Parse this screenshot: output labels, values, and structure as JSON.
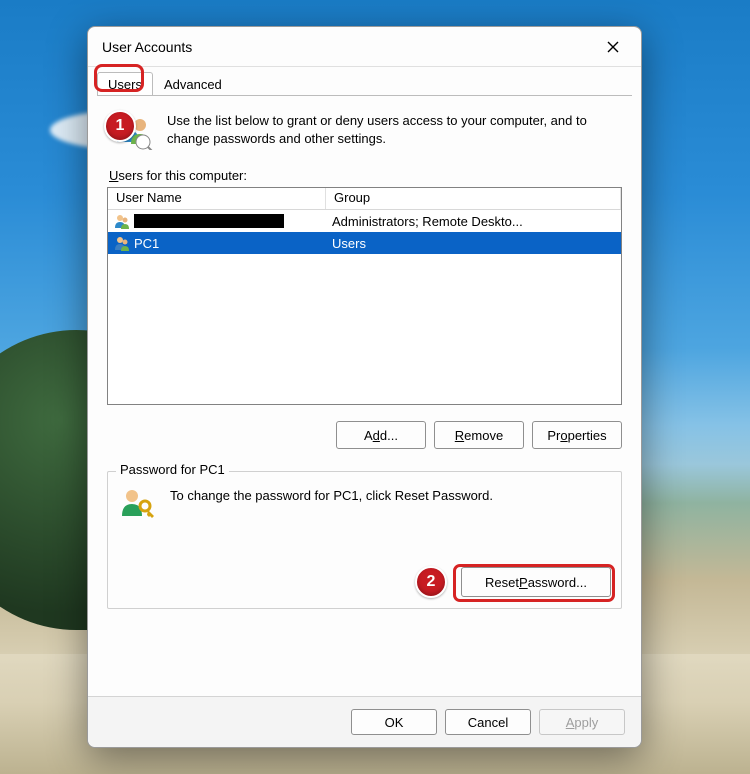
{
  "dialog": {
    "title": "User Accounts",
    "tabs": {
      "users": "Users",
      "advanced": "Advanced"
    },
    "intro": "Use the list below to grant or deny users access to your computer, and to change passwords and other settings.",
    "list_label_prefix": "U",
    "list_label_rest": "sers for this computer:",
    "columns": {
      "name": "User Name",
      "group": "Group"
    },
    "rows": [
      {
        "name_redacted": true,
        "name": "",
        "group": "Administrators; Remote Deskto...",
        "selected": false
      },
      {
        "name_redacted": false,
        "name": "PC1",
        "group": "Users",
        "selected": true
      }
    ],
    "buttons": {
      "add_pre": "A",
      "add_u": "d",
      "add_post": "d...",
      "remove_u": "R",
      "remove_post": "emove",
      "props_pre": "Pr",
      "props_u": "o",
      "props_post": "perties"
    },
    "groupbox": {
      "title": "Password for PC1",
      "text": "To change the password for PC1, click Reset Password.",
      "reset_pre": "Reset ",
      "reset_u": "P",
      "reset_post": "assword..."
    },
    "footer": {
      "ok": "OK",
      "cancel": "Cancel",
      "apply_u": "A",
      "apply_post": "pply"
    }
  },
  "callouts": {
    "one": "1",
    "two": "2"
  }
}
